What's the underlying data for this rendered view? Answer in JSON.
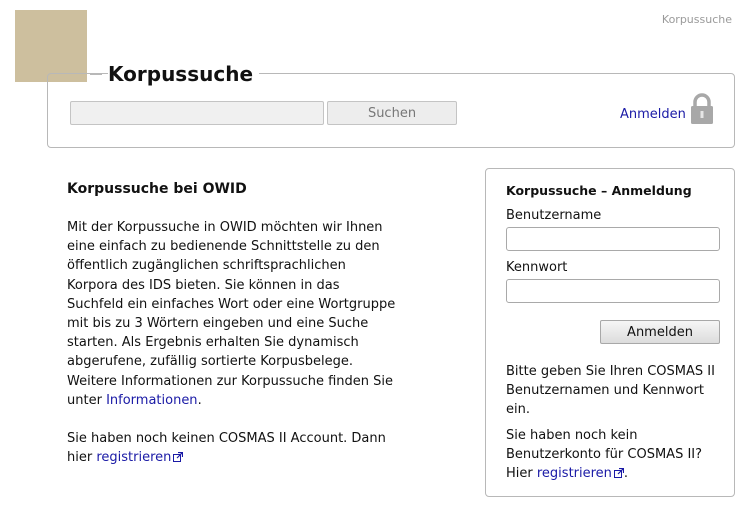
{
  "header": {
    "breadcrumb": "Korpussuche",
    "title": "Korpussuche"
  },
  "search": {
    "input_value": "",
    "button_label": "Suchen",
    "login_link": "Anmelden"
  },
  "intro": {
    "heading": "Korpussuche bei OWID",
    "paragraph1": "Mit der Korpussuche in OWID möchten wir Ihnen eine einfach zu bedienende Schnittstelle zu den öffentlich zugänglichen schriftsprachlichen Korpora des IDS bieten. Sie können in das Suchfeld ein einfaches Wort oder eine Wortgruppe mit bis zu 3 Wörtern eingeben und eine Suche starten. Als Ergebnis erhalten Sie dynamisch abgerufene, zufällig sortierte Korpusbelege. Weitere Informationen zur Korpussuche finden Sie unter ",
    "info_link": "Informationen",
    "paragraph1_end": ".",
    "paragraph2": "Sie haben noch keinen COSMAS II Account. Dann hier ",
    "register_link": "registrieren"
  },
  "login_panel": {
    "heading": "Korpussuche – Anmeldung",
    "username_label": "Benutzername",
    "username_value": "",
    "password_label": "Kennwort",
    "password_value": "",
    "button_label": "Anmelden",
    "hint": "Bitte geben Sie Ihren COSMAS II Benutzernamen und Kennwort ein.",
    "no_account_text": "Sie haben noch kein Benutzerkonto für COSMAS II? Hier ",
    "register_link": "registrieren",
    "no_account_end": "."
  },
  "colors": {
    "link": "#1a1aa6",
    "logo_box": "#cdbf9e",
    "border": "#b8b8b8"
  },
  "icons": {
    "lock": "lock-icon",
    "external": "external-link-icon"
  }
}
